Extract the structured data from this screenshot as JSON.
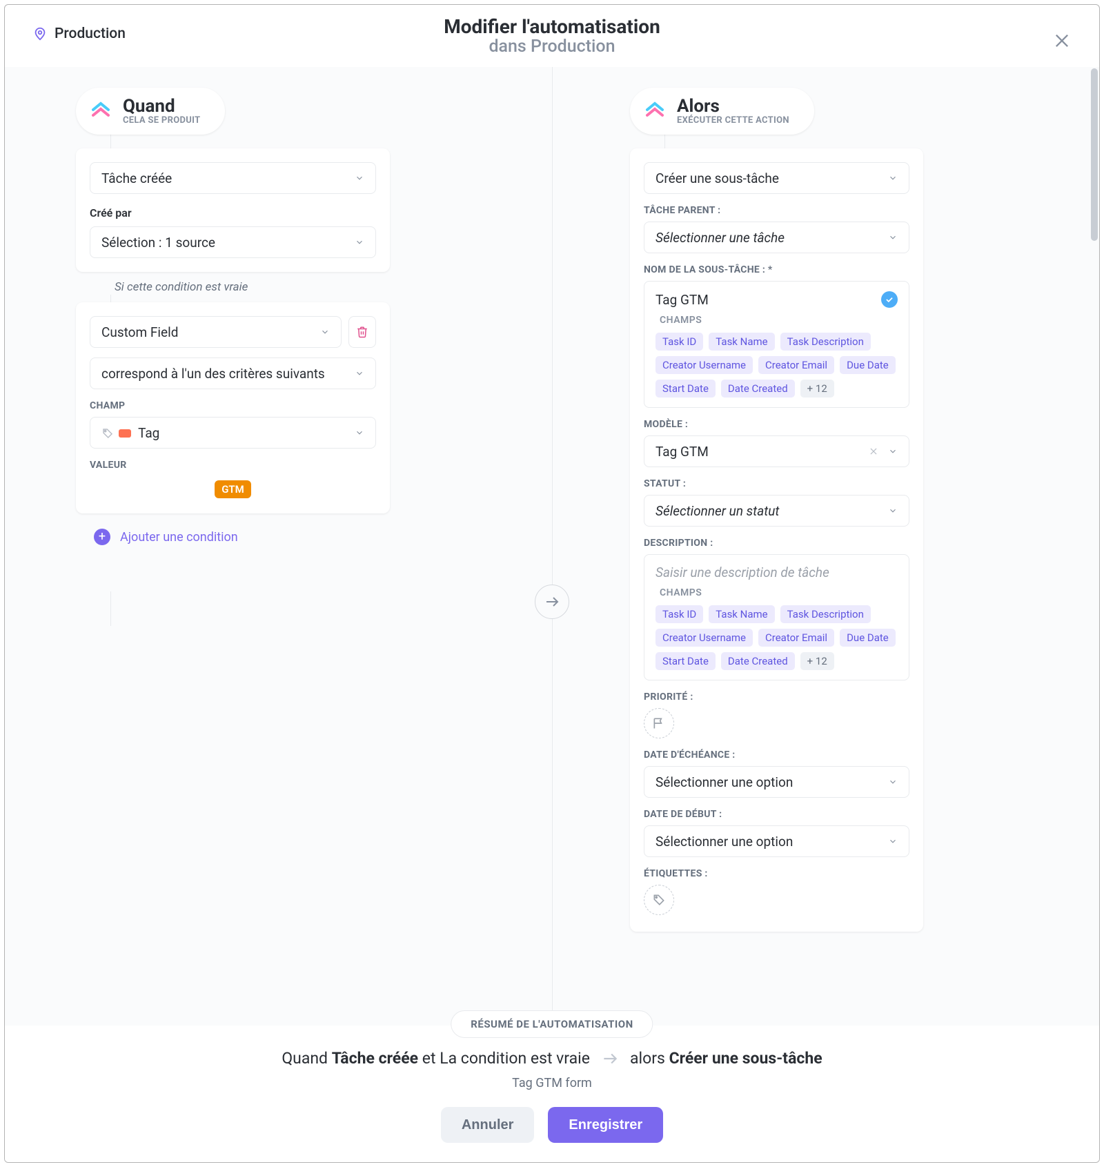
{
  "breadcrumb": {
    "label": "Production"
  },
  "header": {
    "title": "Modifier l'automatisation",
    "subtitle": "dans Production"
  },
  "when": {
    "title": "Quand",
    "subtitle": "CELA SE PRODUIT",
    "trigger": "Tâche créée",
    "created_by_label": "Créé par",
    "created_by_value": "Sélection : 1 source",
    "condition_hint": "Si cette condition est vraie",
    "condition_field": "Custom Field",
    "condition_op": "correspond à l'un des critères suivants",
    "champ_label": "CHAMP",
    "champ_value": "Tag",
    "valeur_label": "VALEUR",
    "valeur_tag": "GTM",
    "add_condition": "Ajouter une condition"
  },
  "then": {
    "title": "Alors",
    "subtitle": "EXÉCUTER CETTE ACTION",
    "action": "Créer une sous-tâche",
    "parent_label": "TÂCHE PARENT :",
    "parent_placeholder": "Sélectionner une tâche",
    "subname_label": "NOM DE LA SOUS-TÂCHE : *",
    "subname_value": "Tag GTM",
    "champs_label": "CHAMPS",
    "chips": [
      "Task ID",
      "Task Name",
      "Task Description",
      "Creator Username",
      "Creator Email",
      "Due Date",
      "Start Date",
      "Date Created"
    ],
    "chip_more": "+ 12",
    "model_label": "MODÈLE :",
    "model_value": "Tag GTM",
    "status_label": "STATUT :",
    "status_placeholder": "Sélectionner un statut",
    "desc_label": "DESCRIPTION :",
    "desc_placeholder": "Saisir une description de tâche",
    "priority_label": "PRIORITÉ :",
    "due_label": "DATE D'ÉCHÉANCE :",
    "due_placeholder": "Sélectionner une option",
    "start_label": "DATE DE DÉBUT :",
    "start_placeholder": "Sélectionner une option",
    "tags_label": "ÉTIQUETTES :"
  },
  "summary": {
    "pill": "RÉSUMÉ DE L'AUTOMATISATION",
    "when_word": "Quand",
    "when_bold": "Tâche créée",
    "cond_text": "et La condition est vraie",
    "then_word": "alors",
    "then_bold": "Créer une sous-tâche",
    "name": "Tag GTM form"
  },
  "buttons": {
    "cancel": "Annuler",
    "save": "Enregistrer"
  }
}
